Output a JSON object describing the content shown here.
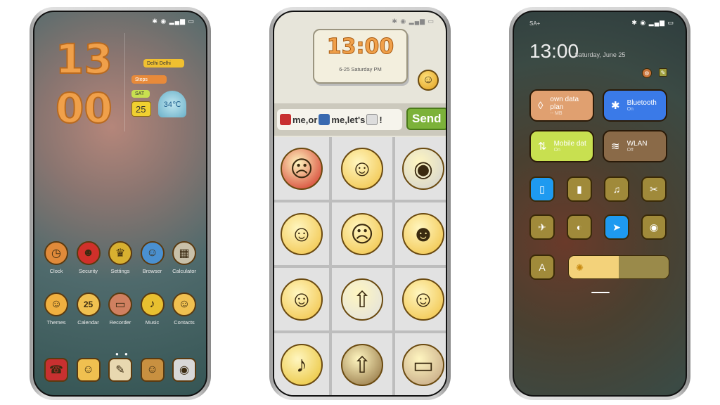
{
  "status_icons": "✱ ◉ ▂▄▆ ▭",
  "home": {
    "clock_hour": "13",
    "clock_minute": "00",
    "location": "Delhi Delhi",
    "steps_label": "Steps",
    "day": "SAT",
    "date": "25",
    "temperature": "34℃",
    "apps": [
      {
        "label": "Clock",
        "icon": "clock-icon",
        "color": "#e08a3a",
        "glyph": "◷"
      },
      {
        "label": "Security",
        "icon": "devil-icon",
        "color": "#d0302a",
        "glyph": "☻"
      },
      {
        "label": "Settings",
        "icon": "trophy-icon",
        "color": "#d8b030",
        "glyph": "♛"
      },
      {
        "label": "Browser",
        "icon": "globe-icon",
        "color": "#4a90d0",
        "glyph": "☺"
      },
      {
        "label": "Calculator",
        "icon": "calculator-icon",
        "color": "#c8c0a8",
        "glyph": "▦"
      },
      {
        "label": "Themes",
        "icon": "smiley-icon",
        "color": "#f0b040",
        "glyph": "☺"
      },
      {
        "label": "Calendar",
        "icon": "calendar-icon",
        "color": "#f0c050",
        "glyph": "25"
      },
      {
        "label": "Recorder",
        "icon": "cassette-icon",
        "color": "#d08060",
        "glyph": "▭"
      },
      {
        "label": "Music",
        "icon": "saxophone-icon",
        "color": "#e8c030",
        "glyph": "♪"
      },
      {
        "label": "Contacts",
        "icon": "thinking-face-icon",
        "color": "#f0c050",
        "glyph": "☺"
      }
    ],
    "dock": [
      {
        "icon": "phone-icon",
        "color": "#c83030",
        "glyph": "☎"
      },
      {
        "icon": "message-icon",
        "color": "#f0c050",
        "glyph": "☺"
      },
      {
        "icon": "notes-icon",
        "color": "#e8d8b0",
        "glyph": "✎"
      },
      {
        "icon": "gallery-icon",
        "color": "#c89040",
        "glyph": "☺"
      },
      {
        "icon": "camera-icon",
        "color": "#d8d8d8",
        "glyph": "◉"
      }
    ]
  },
  "chat": {
    "time": "13:00",
    "date": "6-25 Saturday PM",
    "message_parts": [
      "me,or",
      "me,let's",
      "!"
    ],
    "send_label": "Send",
    "stickers": [
      {
        "icon": "angry-pomegranate-icon",
        "color": "#d02a20",
        "glyph": "☹"
      },
      {
        "icon": "grin-face-icon",
        "color": "#f0c040",
        "glyph": "☺"
      },
      {
        "icon": "camera-icon",
        "color": "#d0d0d0",
        "glyph": "◉"
      },
      {
        "icon": "mask-face-icon",
        "color": "#f0c040",
        "glyph": "☺"
      },
      {
        "icon": "meh-face-icon",
        "color": "#f0c040",
        "glyph": "☹"
      },
      {
        "icon": "sunglasses-face-icon",
        "color": "#f0c040",
        "glyph": "☻"
      },
      {
        "icon": "laughing-face-icon",
        "color": "#f0c040",
        "glyph": "☺"
      },
      {
        "icon": "rocket-icon",
        "color": "#e0e0e0",
        "glyph": "⇧"
      },
      {
        "icon": "wink-face-icon",
        "color": "#f0c040",
        "glyph": "☺"
      },
      {
        "icon": "saxophone-icon",
        "color": "#e8c030",
        "glyph": "♪"
      },
      {
        "icon": "tv-icon",
        "color": "#8a6a3a",
        "glyph": "⇧"
      },
      {
        "icon": "cassette-icon",
        "color": "#c0a080",
        "glyph": "▭"
      }
    ]
  },
  "control": {
    "carrier": "SA+",
    "time": "13:00",
    "date": "Saturday, June 25",
    "tiles": [
      {
        "label": "own data plan",
        "sub": "-- MB",
        "icon": "drop-icon",
        "glyph": "◊",
        "color": "#e0a070"
      },
      {
        "label": "Bluetooth",
        "sub": "On",
        "icon": "bluetooth-icon",
        "glyph": "✱",
        "color": "#3a7ae8"
      },
      {
        "label": "Mobile dat",
        "sub": "On",
        "icon": "mobile-data-icon",
        "glyph": "⇅",
        "color": "#c8e050"
      },
      {
        "label": "WLAN",
        "sub": "Off",
        "icon": "wifi-icon",
        "glyph": "≋",
        "color": "#8a6a48"
      }
    ],
    "toggles": [
      {
        "icon": "vibrate-icon",
        "glyph": "▯",
        "on": true
      },
      {
        "icon": "flashlight-icon",
        "glyph": "▮",
        "on": false
      },
      {
        "icon": "bell-icon",
        "glyph": "♫",
        "on": false
      },
      {
        "icon": "screenshot-icon",
        "glyph": "✂",
        "on": false
      },
      {
        "icon": "airplane-icon",
        "glyph": "✈",
        "on": false
      },
      {
        "icon": "dark-mode-icon",
        "glyph": "◐",
        "on": false
      },
      {
        "icon": "location-icon",
        "glyph": "➤",
        "on": true
      },
      {
        "icon": "eye-icon",
        "glyph": "◉",
        "on": false
      }
    ],
    "auto_brightness_label": "A",
    "brightness": 0.5
  }
}
